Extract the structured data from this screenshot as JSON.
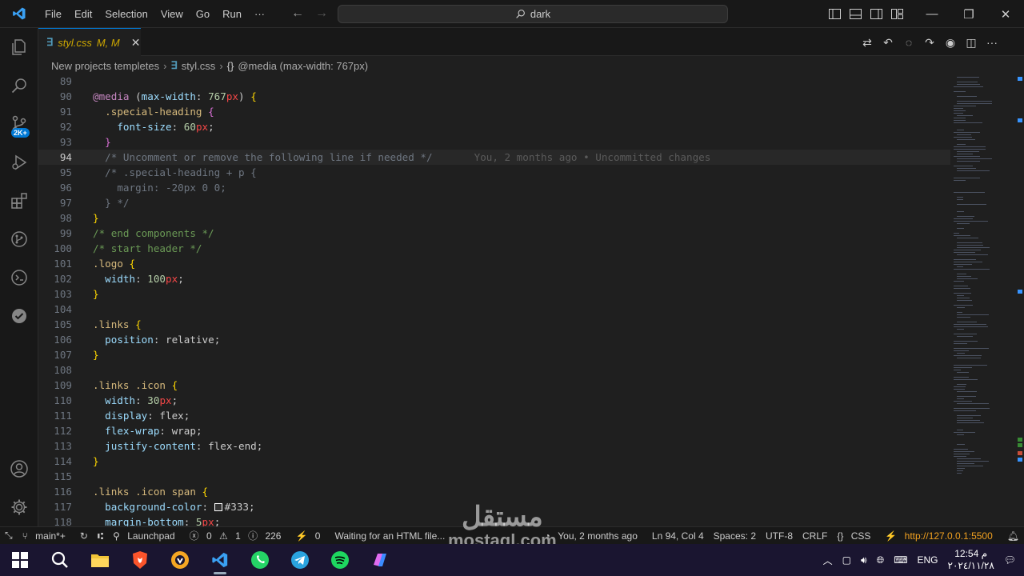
{
  "titlebar": {
    "menu": [
      "File",
      "Edit",
      "Selection",
      "View",
      "Go",
      "Run",
      "···"
    ],
    "command_center": "dark"
  },
  "activity_bar": {
    "scm_badge": "2K+"
  },
  "tab": {
    "filename": "styl.css",
    "status": "M, M"
  },
  "breadcrumb": {
    "folder": "New projects templetes",
    "file": "styl.css",
    "symbol": "@media (max-width: 767px)"
  },
  "code": {
    "current_line": 94,
    "blame": "You, 2 months ago • Uncommitted changes",
    "lines": [
      {
        "n": "89",
        "t": ""
      },
      {
        "n": "90",
        "t": "@media (max-width: 767px) {"
      },
      {
        "n": "91",
        "t": "  .special-heading {"
      },
      {
        "n": "92",
        "t": "    font-size: 60px;"
      },
      {
        "n": "93",
        "t": "  }"
      },
      {
        "n": "94",
        "t": "  /* Uncomment or remove the following line if needed */"
      },
      {
        "n": "95",
        "t": "  /* .special-heading + p {"
      },
      {
        "n": "96",
        "t": "    margin: -20px 0 0;"
      },
      {
        "n": "97",
        "t": "  } */"
      },
      {
        "n": "98",
        "t": "}"
      },
      {
        "n": "99",
        "t": "/* end components */"
      },
      {
        "n": "100",
        "t": "/* start header */"
      },
      {
        "n": "101",
        "t": ".logo {"
      },
      {
        "n": "102",
        "t": "  width: 100px;"
      },
      {
        "n": "103",
        "t": "}"
      },
      {
        "n": "104",
        "t": ""
      },
      {
        "n": "105",
        "t": ".links {"
      },
      {
        "n": "106",
        "t": "  position: relative;"
      },
      {
        "n": "107",
        "t": "}"
      },
      {
        "n": "108",
        "t": ""
      },
      {
        "n": "109",
        "t": ".links .icon {"
      },
      {
        "n": "110",
        "t": "  width: 30px;"
      },
      {
        "n": "111",
        "t": "  display: flex;"
      },
      {
        "n": "112",
        "t": "  flex-wrap: wrap;"
      },
      {
        "n": "113",
        "t": "  justify-content: flex-end;"
      },
      {
        "n": "114",
        "t": "}"
      },
      {
        "n": "115",
        "t": ""
      },
      {
        "n": "116",
        "t": ".links .icon span {"
      },
      {
        "n": "117",
        "t": "  background-color: #333;"
      },
      {
        "n": "118",
        "t": "  margin-bottom: 5px;"
      }
    ]
  },
  "statusbar": {
    "branch": "main*+",
    "launchpad": "Launchpad",
    "errors": "0",
    "warnings": "1",
    "info": "226",
    "ports": "0",
    "waiting": "Waiting for an HTML file...",
    "blame": "You, 2 months ago",
    "position": "Ln 94, Col 4",
    "spaces": "Spaces: 2",
    "encoding": "UTF-8",
    "eol": "CRLF",
    "language": "CSS",
    "live_server": "http://127.0.0.1:5500"
  },
  "taskbar": {
    "language": "ENG",
    "time": "12:54 م",
    "date": "٢٠٢٤/١١/٢٨"
  },
  "watermark": {
    "arabic": "مستقل",
    "latin": "mostaql.com"
  },
  "colors": {
    "accent": "#0078d4",
    "modified": "#cca700",
    "background": "#1f1f1f"
  }
}
